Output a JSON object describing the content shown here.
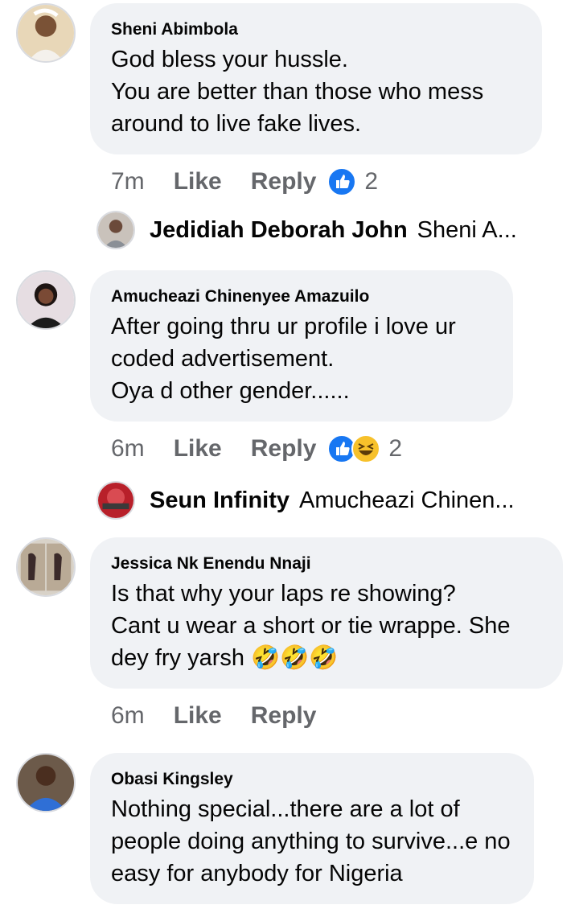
{
  "comments": [
    {
      "author": "Sheni Abimbola",
      "text": "God bless your hussle.\nYou are better than those who mess around to live fake lives.",
      "time": "7m",
      "like_label": "Like",
      "reply_label": "Reply",
      "reaction_count": "2",
      "reactions": [
        "like-reaction-icon"
      ]
    },
    {
      "author": "Amucheazi Chinenyee Amazuilo",
      "text": "After going thru ur profile i love ur coded advertisement.\nOya d other gender......",
      "time": "6m",
      "like_label": "Like",
      "reply_label": "Reply",
      "reaction_count": "2",
      "reactions": [
        "like-reaction-icon",
        "haha-reaction-icon"
      ]
    },
    {
      "author": "Jessica Nk Enendu Nnaji",
      "text": "Is that why your laps re showing?\nCant u wear a short or tie wrappe. She dey fry yarsh",
      "emojis": [
        "🤣",
        "🤣",
        "🤣"
      ],
      "time": "6m",
      "like_label": "Like",
      "reply_label": "Reply"
    },
    {
      "author": "Obasi Kingsley",
      "text": "Nothing special...there are a lot of people doing anything to survive...e no easy for anybody for Nigeria"
    }
  ],
  "replies": [
    {
      "author": "Jedidiah Deborah John",
      "preview": "Sheni A..."
    },
    {
      "author": "Seun Infinity",
      "preview": "Amucheazi Chinen..."
    }
  ],
  "colors": {
    "bubble": "#f0f2f5",
    "meta_text": "#65676b",
    "like_blue": "#1877f2",
    "haha_yellow": "#f7c12b"
  }
}
